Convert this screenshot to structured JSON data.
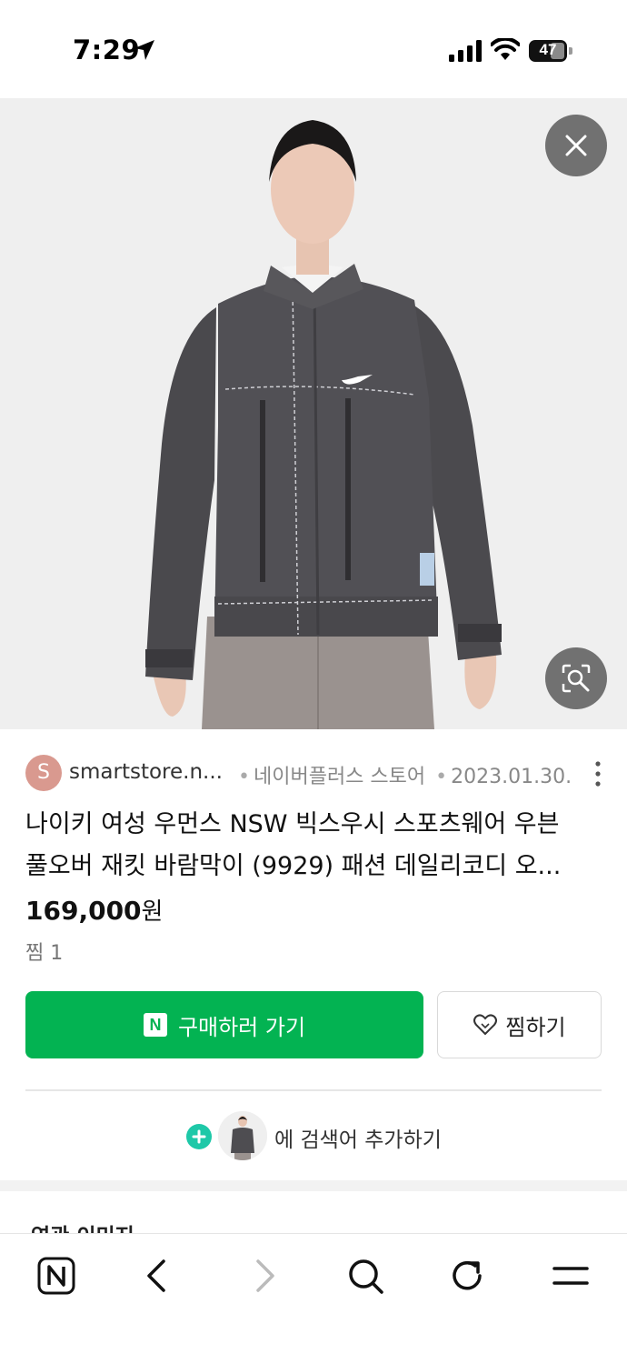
{
  "status_bar": {
    "time": "7:29",
    "battery": "47"
  },
  "image": {
    "close_icon": "close-icon",
    "lens_icon": "image-search-icon"
  },
  "store": {
    "avatar_letter": "S",
    "name": "smartstore.n...",
    "meta": [
      "네이버플러스 스토어",
      "2023.01.30."
    ]
  },
  "product": {
    "title_line1": "나이키 여성 우먼스 NSW 빅스우시 스포츠웨어 우븐",
    "title_line2": "풀오버 재킷 바람막이 (9929) 패션 데일리코디 오...",
    "price": "169,000",
    "price_unit": "원",
    "likes": "찜 1"
  },
  "actions": {
    "buy_label": "구매하러 가기",
    "buy_logo": "N",
    "wish_label": "찜하기"
  },
  "add_search": {
    "label": "에 검색어 추가하기"
  },
  "related": {
    "title": "연관 이미지"
  },
  "toolbar": {
    "items": [
      "naver-home-icon",
      "back-icon",
      "forward-icon",
      "search-icon",
      "refresh-icon",
      "menu-icon"
    ]
  },
  "colors": {
    "accent_green": "#03b352",
    "plus_mint": "#1ec8a8",
    "avatar": "#d9998f"
  }
}
